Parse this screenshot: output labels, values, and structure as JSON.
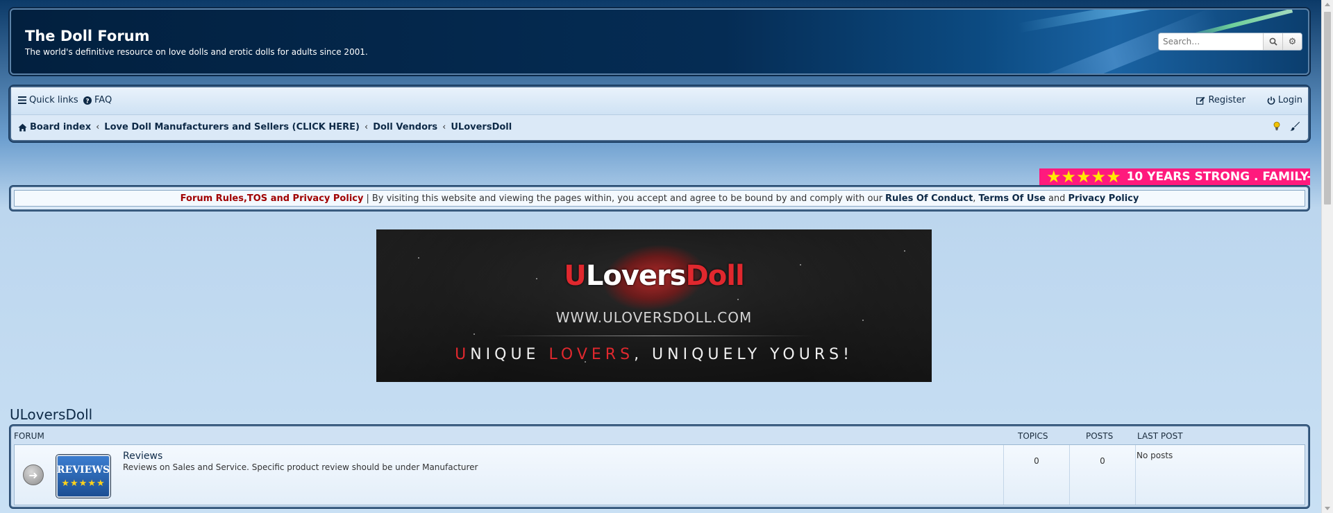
{
  "header": {
    "site_title": "The Doll Forum",
    "site_description": "The world's definitive resource on love dolls and erotic dolls for adults since 2001.",
    "search_placeholder": "Search…"
  },
  "navbar": {
    "quick_links": "Quick links",
    "faq": "FAQ",
    "register": "Register",
    "login": "Login",
    "breadcrumbs": [
      "Board index",
      "Love Doll Manufacturers and Sellers (CLICK HERE)",
      "Doll Vendors",
      "ULoversDoll"
    ],
    "separator": "‹"
  },
  "marquee": {
    "stars": "★★★★★",
    "text": "10 YEARS STRONG . FAMILY-"
  },
  "rules": {
    "rules_link": "Forum Rules,TOS and Privacy Policy",
    "divider": "|",
    "text": "By visiting this website and viewing the pages within, you accept and agree to be bound by and comply with our",
    "conduct": "Rules Of Conduct",
    "comma": ",",
    "terms": "Terms Of Use",
    "and": "and",
    "privacy": "Privacy Policy"
  },
  "banner": {
    "brand_u": "U",
    "brand_lovers": "Lovers",
    "brand_doll": "Doll",
    "url": "WWW.ULOVERSDOLL.COM",
    "slogan_u": "U",
    "slogan_nique": "NIQUE ",
    "slogan_lovers": "LOVERS",
    "slogan_rest": ", UNIQUELY YOURS!"
  },
  "forum_section": {
    "title": "ULoversDoll",
    "headers": {
      "forum": "Forum",
      "topics": "Topics",
      "posts": "Posts",
      "last_post": "Last post"
    },
    "rows": [
      {
        "icon_label": "REVIEWS",
        "icon_stars": "★★★★★",
        "name": "Reviews",
        "description": "Reviews on Sales and Service. Specific product review should be under Manufacturer",
        "topics": "0",
        "posts": "0",
        "last_post": "No posts"
      }
    ]
  },
  "colors": {
    "accent_red": "#a00000",
    "marquee_bg": "#ff1a7d",
    "link": "#0e2a47"
  }
}
